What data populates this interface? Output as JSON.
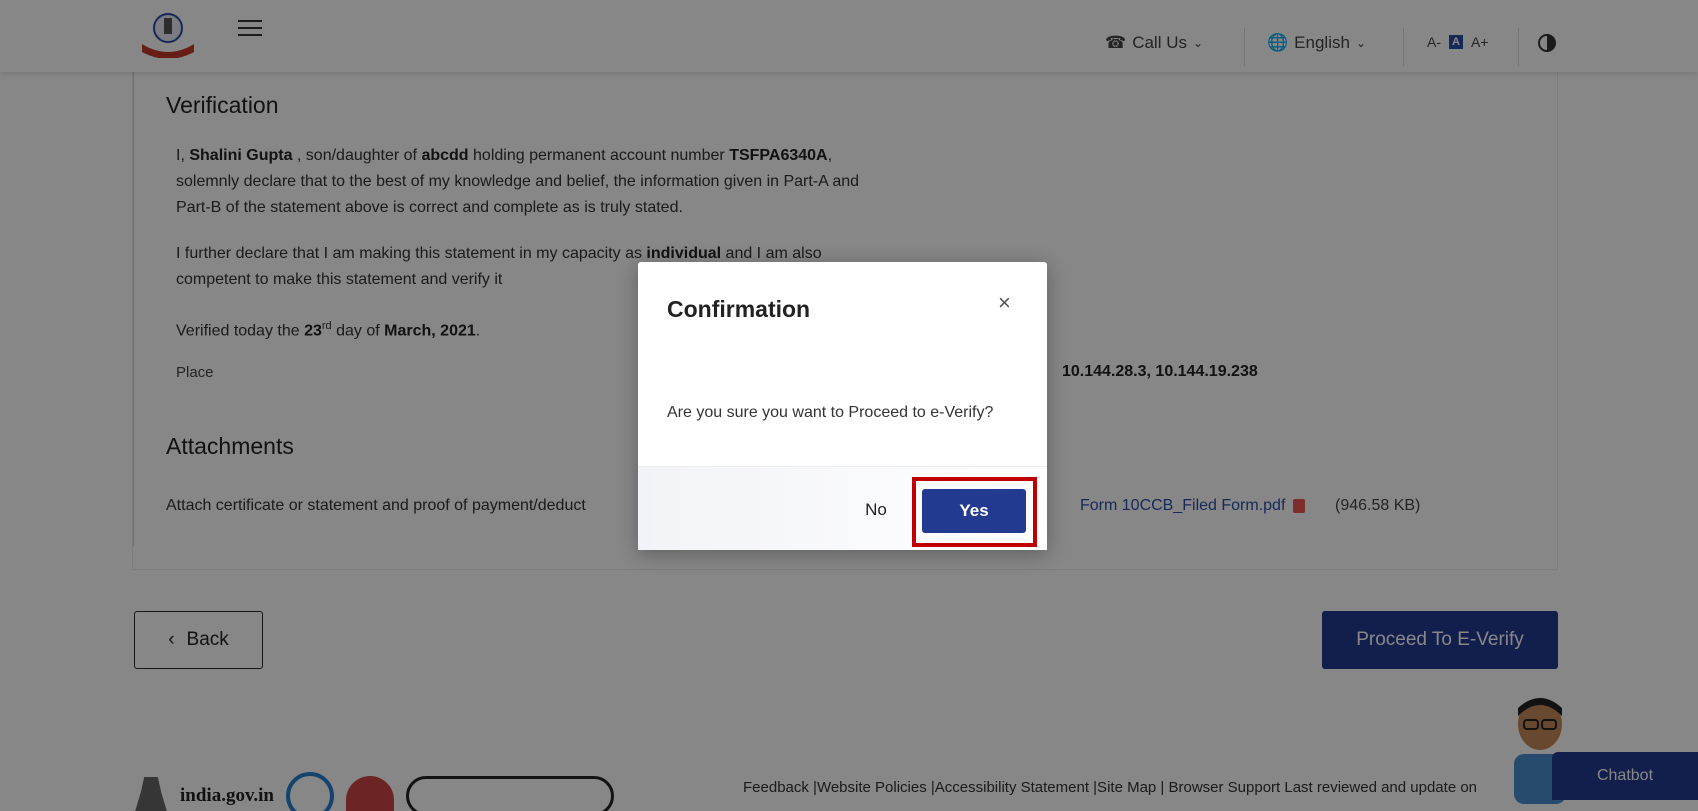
{
  "header": {
    "call_us": "Call Us",
    "language": "English",
    "font_decrease": "A-",
    "font_normal": "A",
    "font_increase": "A+"
  },
  "verification": {
    "title": "Verification",
    "line1_pre": "I, ",
    "name": "Shalini Gupta",
    "line1_mid": " , son/daughter of ",
    "parent": "abcdd",
    "line1_mid2": " holding permanent account number ",
    "pan": "TSFPA6340A",
    "line1_post": ",",
    "line2": "solemnly declare that to the best of my knowledge and belief, the information given in Part-A and",
    "line3": "Part-B of the statement above is correct and complete as is truly stated.",
    "line4_pre": "I further declare that I am making this statement in my capacity as ",
    "capacity": "individual",
    "line4_post": " and I am also",
    "line5": "competent to make this statement and verify it",
    "verified_pre": "Verified today the ",
    "day": "23",
    "day_suffix": "rd",
    "verified_mid": " day of ",
    "month_year": "March, 2021",
    "verified_post": ".",
    "place_label": "Place",
    "ip_addresses": "10.144.28.3, 10.144.19.238"
  },
  "attachments": {
    "title": "Attachments",
    "description": "Attach certificate or statement and proof of payment/deduct",
    "file_name": "Form 10CCB_Filed Form.pdf",
    "file_size": "(946.58 KB)"
  },
  "actions": {
    "back_label": "Back",
    "proceed_label": "Proceed To E-Verify"
  },
  "footer": {
    "site": "india.gov.in",
    "links": "Feedback |Website Policies |Accessibility Statement |Site Map | Browser Support   Last reviewed and update on"
  },
  "chatbot": {
    "label": "Chatbot"
  },
  "modal": {
    "title": "Confirmation",
    "close": "×",
    "message": "Are you sure you want to Proceed to e-Verify?",
    "no_label": "No",
    "yes_label": "Yes"
  },
  "colors": {
    "primary": "#223a8f",
    "highlight": "#c00000",
    "overlay": "rgba(0,0,0,0.47)"
  }
}
